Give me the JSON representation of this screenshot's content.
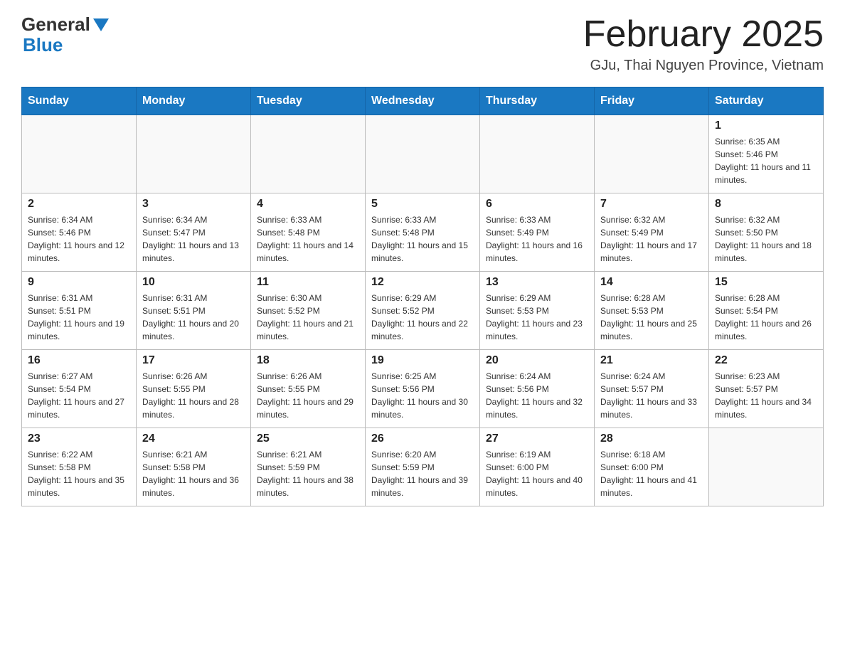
{
  "header": {
    "logo_general": "General",
    "logo_blue": "Blue",
    "title": "February 2025",
    "subtitle": "GJu, Thai Nguyen Province, Vietnam"
  },
  "days_of_week": [
    "Sunday",
    "Monday",
    "Tuesday",
    "Wednesday",
    "Thursday",
    "Friday",
    "Saturday"
  ],
  "weeks": [
    {
      "days": [
        {
          "number": "",
          "info": ""
        },
        {
          "number": "",
          "info": ""
        },
        {
          "number": "",
          "info": ""
        },
        {
          "number": "",
          "info": ""
        },
        {
          "number": "",
          "info": ""
        },
        {
          "number": "",
          "info": ""
        },
        {
          "number": "1",
          "info": "Sunrise: 6:35 AM\nSunset: 5:46 PM\nDaylight: 11 hours and 11 minutes."
        }
      ]
    },
    {
      "days": [
        {
          "number": "2",
          "info": "Sunrise: 6:34 AM\nSunset: 5:46 PM\nDaylight: 11 hours and 12 minutes."
        },
        {
          "number": "3",
          "info": "Sunrise: 6:34 AM\nSunset: 5:47 PM\nDaylight: 11 hours and 13 minutes."
        },
        {
          "number": "4",
          "info": "Sunrise: 6:33 AM\nSunset: 5:48 PM\nDaylight: 11 hours and 14 minutes."
        },
        {
          "number": "5",
          "info": "Sunrise: 6:33 AM\nSunset: 5:48 PM\nDaylight: 11 hours and 15 minutes."
        },
        {
          "number": "6",
          "info": "Sunrise: 6:33 AM\nSunset: 5:49 PM\nDaylight: 11 hours and 16 minutes."
        },
        {
          "number": "7",
          "info": "Sunrise: 6:32 AM\nSunset: 5:49 PM\nDaylight: 11 hours and 17 minutes."
        },
        {
          "number": "8",
          "info": "Sunrise: 6:32 AM\nSunset: 5:50 PM\nDaylight: 11 hours and 18 minutes."
        }
      ]
    },
    {
      "days": [
        {
          "number": "9",
          "info": "Sunrise: 6:31 AM\nSunset: 5:51 PM\nDaylight: 11 hours and 19 minutes."
        },
        {
          "number": "10",
          "info": "Sunrise: 6:31 AM\nSunset: 5:51 PM\nDaylight: 11 hours and 20 minutes."
        },
        {
          "number": "11",
          "info": "Sunrise: 6:30 AM\nSunset: 5:52 PM\nDaylight: 11 hours and 21 minutes."
        },
        {
          "number": "12",
          "info": "Sunrise: 6:29 AM\nSunset: 5:52 PM\nDaylight: 11 hours and 22 minutes."
        },
        {
          "number": "13",
          "info": "Sunrise: 6:29 AM\nSunset: 5:53 PM\nDaylight: 11 hours and 23 minutes."
        },
        {
          "number": "14",
          "info": "Sunrise: 6:28 AM\nSunset: 5:53 PM\nDaylight: 11 hours and 25 minutes."
        },
        {
          "number": "15",
          "info": "Sunrise: 6:28 AM\nSunset: 5:54 PM\nDaylight: 11 hours and 26 minutes."
        }
      ]
    },
    {
      "days": [
        {
          "number": "16",
          "info": "Sunrise: 6:27 AM\nSunset: 5:54 PM\nDaylight: 11 hours and 27 minutes."
        },
        {
          "number": "17",
          "info": "Sunrise: 6:26 AM\nSunset: 5:55 PM\nDaylight: 11 hours and 28 minutes."
        },
        {
          "number": "18",
          "info": "Sunrise: 6:26 AM\nSunset: 5:55 PM\nDaylight: 11 hours and 29 minutes."
        },
        {
          "number": "19",
          "info": "Sunrise: 6:25 AM\nSunset: 5:56 PM\nDaylight: 11 hours and 30 minutes."
        },
        {
          "number": "20",
          "info": "Sunrise: 6:24 AM\nSunset: 5:56 PM\nDaylight: 11 hours and 32 minutes."
        },
        {
          "number": "21",
          "info": "Sunrise: 6:24 AM\nSunset: 5:57 PM\nDaylight: 11 hours and 33 minutes."
        },
        {
          "number": "22",
          "info": "Sunrise: 6:23 AM\nSunset: 5:57 PM\nDaylight: 11 hours and 34 minutes."
        }
      ]
    },
    {
      "days": [
        {
          "number": "23",
          "info": "Sunrise: 6:22 AM\nSunset: 5:58 PM\nDaylight: 11 hours and 35 minutes."
        },
        {
          "number": "24",
          "info": "Sunrise: 6:21 AM\nSunset: 5:58 PM\nDaylight: 11 hours and 36 minutes."
        },
        {
          "number": "25",
          "info": "Sunrise: 6:21 AM\nSunset: 5:59 PM\nDaylight: 11 hours and 38 minutes."
        },
        {
          "number": "26",
          "info": "Sunrise: 6:20 AM\nSunset: 5:59 PM\nDaylight: 11 hours and 39 minutes."
        },
        {
          "number": "27",
          "info": "Sunrise: 6:19 AM\nSunset: 6:00 PM\nDaylight: 11 hours and 40 minutes."
        },
        {
          "number": "28",
          "info": "Sunrise: 6:18 AM\nSunset: 6:00 PM\nDaylight: 11 hours and 41 minutes."
        },
        {
          "number": "",
          "info": ""
        }
      ]
    }
  ]
}
